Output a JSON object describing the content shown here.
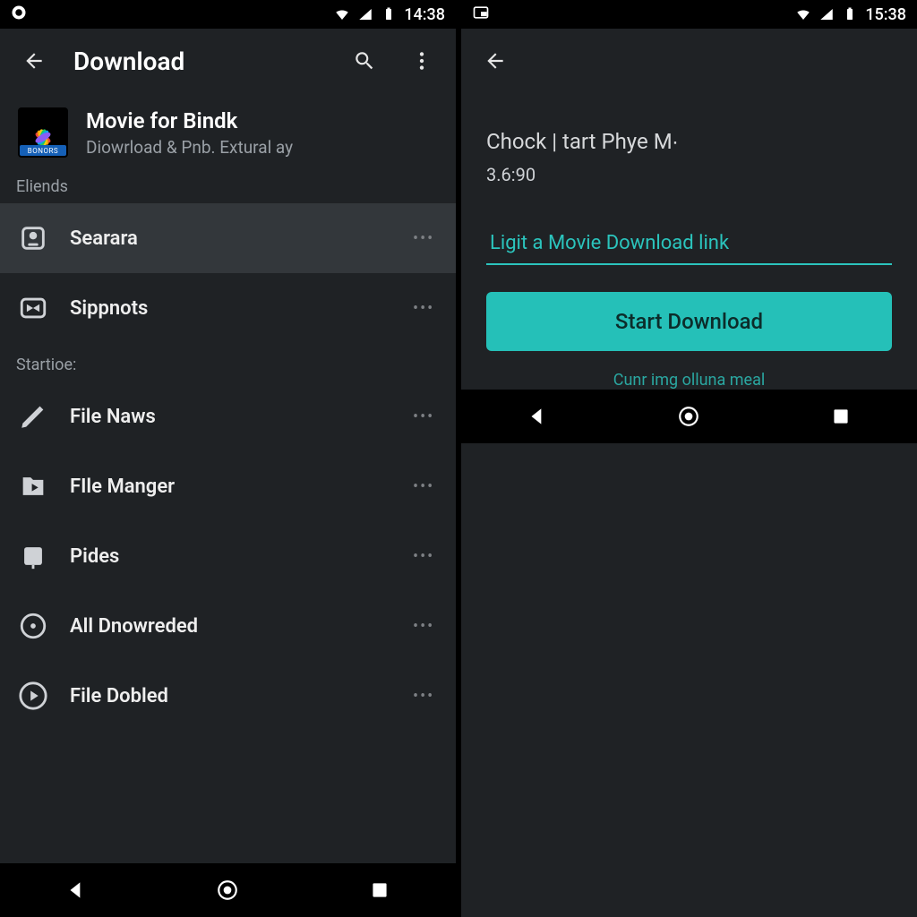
{
  "colors": {
    "accent": "#25c0b8",
    "bg": "#1f2225"
  },
  "left": {
    "status": {
      "time": "14:38"
    },
    "appbar": {
      "title": "Download"
    },
    "featured": {
      "title": "Movie for Bindk",
      "subtitle": "Diowrload & Pnb. Extural ay",
      "icon_badge": "BONORS"
    },
    "sections": [
      {
        "label": "Eliends",
        "items": [
          {
            "icon": "camera-icon",
            "label": "Searara",
            "selected": true
          },
          {
            "icon": "bowtie-icon",
            "label": "Sippnots",
            "selected": false
          }
        ]
      },
      {
        "label": "Startioe:",
        "items": [
          {
            "icon": "pencil-icon",
            "label": "File Naws"
          },
          {
            "icon": "folder-play-icon",
            "label": "FIle Manger"
          },
          {
            "icon": "square-icon",
            "label": "Pides"
          },
          {
            "icon": "target-icon",
            "label": "All Dnowreded"
          },
          {
            "icon": "play-circle-icon",
            "label": "File Dobled"
          }
        ]
      }
    ]
  },
  "right": {
    "status": {
      "time": "15:38"
    },
    "page": {
      "title": "Chock | tart Phye M∙",
      "subtitle": "3.6:90",
      "input_placeholder": "Ligit a Movie Download link",
      "cta_label": "Start Download",
      "helper": "Cunr img olluna meal"
    }
  }
}
